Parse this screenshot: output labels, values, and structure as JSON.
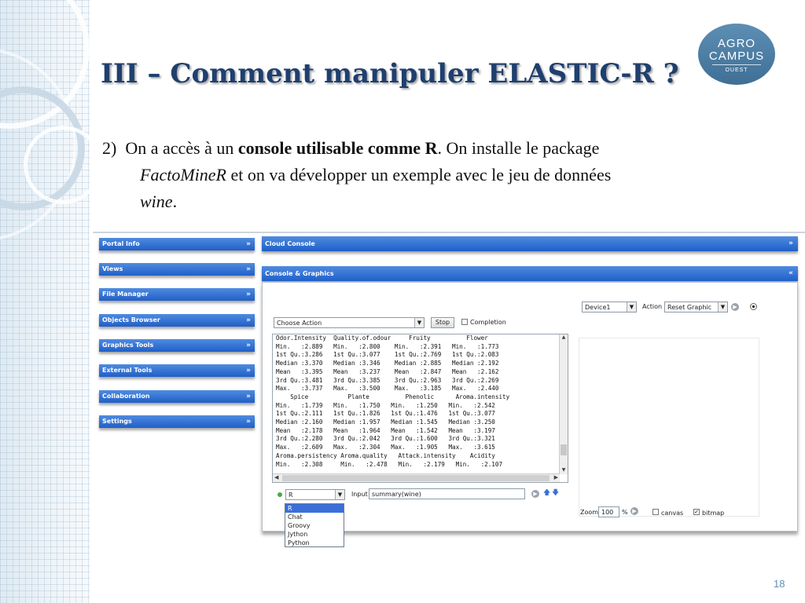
{
  "slide": {
    "title": "III – Comment manipuler ELASTIC-R ?",
    "para_num": "2)",
    "para_t1": "On a accès à un ",
    "para_bold": "console utilisable comme R",
    "para_t2": ". On installe le package",
    "para_italic1": "FactoMineR",
    "para_t3": " et on va développer un exemple avec le jeu de données",
    "para_italic2": "wine",
    "para_t4": ".",
    "slide_number": "18",
    "logo": {
      "line1": "AGRO",
      "line2": "CAMPUS",
      "line3": "OUEST"
    }
  },
  "sidebar": {
    "items": [
      {
        "label": "Portal Info"
      },
      {
        "label": "Views"
      },
      {
        "label": "File Manager"
      },
      {
        "label": "Objects Browser"
      },
      {
        "label": "Graphics Tools"
      },
      {
        "label": "External Tools"
      },
      {
        "label": "Collaboration"
      },
      {
        "label": "Settings"
      }
    ],
    "chevron": "»"
  },
  "cloud_console": {
    "title": "Cloud Console",
    "chevron": "»"
  },
  "console_graphics": {
    "title": "Console & Graphics",
    "chevron": "«",
    "device_select": "Device1",
    "action_label": "Action",
    "action_select": "Reset Graphic",
    "choose_action": "Choose Action",
    "stop_label": "Stop",
    "completion_label": "Completion",
    "console_lines": [
      "Odor.Intensity  Quality.of.odour     Fruity          Flower",
      "Min.   :2.889   Min.   :2.800    Min.   :2.391   Min.   :1.773",
      "1st Qu.:3.286   1st Qu.:3.077    1st Qu.:2.769   1st Qu.:2.083",
      "Median :3.370   Median :3.346    Median :2.885   Median :2.192",
      "Mean   :3.395   Mean   :3.237    Mean   :2.847   Mean   :2.162",
      "3rd Qu.:3.481   3rd Qu.:3.385    3rd Qu.:2.963   3rd Qu.:2.269",
      "Max.   :3.737   Max.   :3.500    Max.   :3.185   Max.   :2.440",
      "    Spice           Plante          Phenolic      Aroma.intensity",
      "Min.   :1.739   Min.   :1.750   Min.   :1.250   Min.   :2.542",
      "1st Qu.:2.111   1st Qu.:1.826   1st Qu.:1.476   1st Qu.:3.077",
      "Median :2.160   Median :1.957   Median :1.545   Median :3.250",
      "Mean   :2.178   Mean   :1.964   Mean   :1.542   Mean   :3.197",
      "3rd Qu.:2.280   3rd Qu.:2.042   3rd Qu.:1.600   3rd Qu.:3.321",
      "Max.   :2.609   Max.   :2.304   Max.   :1.905   Max.   :3.615",
      "Aroma.persistency Aroma.quality   Attack.intensity    Acidity",
      "Min.   :2.308     Min.   :2.478   Min.   :2.179   Min.   :2.107"
    ],
    "language_select": "R",
    "language_options": [
      "R",
      "Chat",
      "Groovy",
      "Jython",
      "Python"
    ],
    "input_label": "Input",
    "input_value": "summary(wine)",
    "zoom_label": "Zoom",
    "zoom_value": "100",
    "zoom_unit": "%",
    "canvas_label": "canvas",
    "bitmap_label": "bitmap"
  },
  "colors": {
    "title": "#1f3f6e",
    "panel_blue": "#1f5fc8",
    "logo": "#4a7aa0"
  }
}
